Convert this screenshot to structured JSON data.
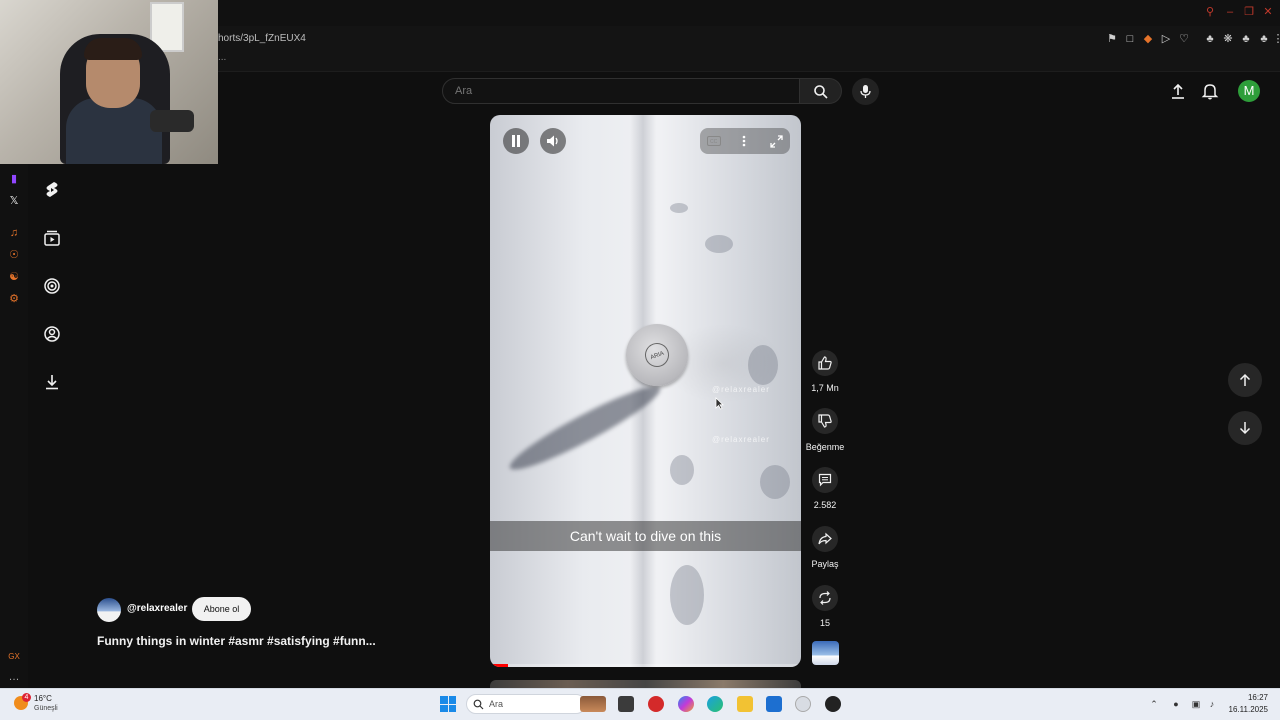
{
  "browser": {
    "url": "horts/3pL_fZnEUX4",
    "url_sub": "..."
  },
  "search": {
    "placeholder": "Ara"
  },
  "header": {
    "avatar_letter": "M"
  },
  "video": {
    "caption": "Can't wait to dive on this",
    "disc_text": "ARIA",
    "watermark": "@relaxrealer"
  },
  "actions": {
    "like_count": "1,7 Mn",
    "dislike_label": "Beğenme",
    "comment_count": "2.582",
    "share_label": "Paylaş",
    "remix_count": "15"
  },
  "channel": {
    "handle": "@relaxrealer",
    "subscribe_label": "Abone ol",
    "title": "Funny things in winter #asmr #satisfying  #funn..."
  },
  "taskbar": {
    "weather_temp": "16°C",
    "weather_desc": "Güneşli",
    "weather_badge": "4",
    "search_label": "Ara",
    "time": "16:27",
    "date": "16.11.2025"
  }
}
